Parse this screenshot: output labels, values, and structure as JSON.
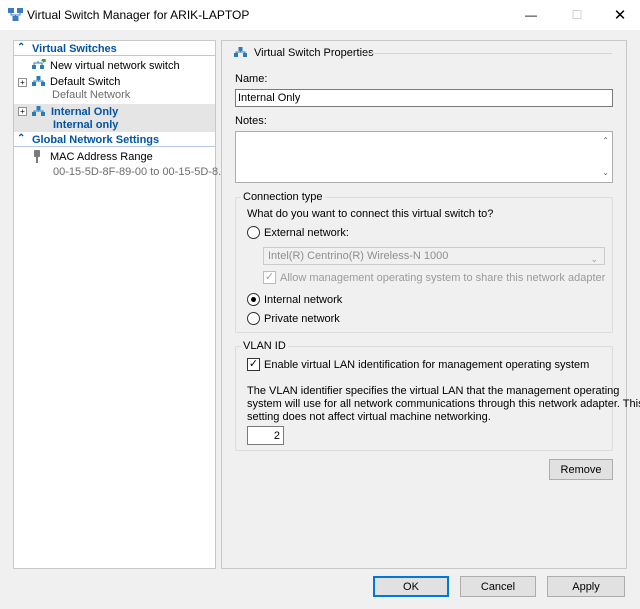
{
  "window": {
    "title": "Virtual Switch Manager for ARIK-LAPTOP"
  },
  "left_pane": {
    "virtual_switches_header": "Virtual Switches",
    "new_switch_label": "New virtual network switch",
    "switches": [
      {
        "name": "Default Switch",
        "type": "Default Network"
      },
      {
        "name": "Internal Only",
        "type": "Internal only"
      }
    ],
    "global_header": "Global Network Settings",
    "mac_range_label": "MAC Address Range",
    "mac_range_value": "00-15-5D-8F-89-00 to 00-15-5D-8..."
  },
  "properties": {
    "group_title": "Virtual Switch Properties",
    "name_label": "Name:",
    "name_value": "Internal Only",
    "notes_label": "Notes:",
    "notes_value": "",
    "connection_type": {
      "legend": "Connection type",
      "question": "What do you want to connect this virtual switch to?",
      "external_label": "External network:",
      "adapter_value": "Intel(R) Centrino(R) Wireless-N 1000",
      "allow_mgmt_label": "Allow management operating system to share this network adapter",
      "allow_mgmt_checked": true,
      "internal_label": "Internal network",
      "private_label": "Private network",
      "selected": "internal"
    },
    "vlan": {
      "legend": "VLAN ID",
      "enable_label": "Enable virtual LAN identification for management operating system",
      "enable_checked": true,
      "description_line1": "The VLAN identifier specifies the virtual LAN that the management operating",
      "description_line2": "system will use for all network communications through this network adapter. This",
      "description_line3": "setting does not affect virtual machine networking.",
      "vlan_value": "2"
    },
    "remove_label": "Remove"
  },
  "footer": {
    "ok_label": "OK",
    "cancel_label": "Cancel",
    "apply_label": "Apply"
  },
  "colors": {
    "accent": "#0078d7",
    "section_header": "#0054a6",
    "switch_icon": "#2b7bb9",
    "new_switch_icon": "#3a9b3a"
  }
}
